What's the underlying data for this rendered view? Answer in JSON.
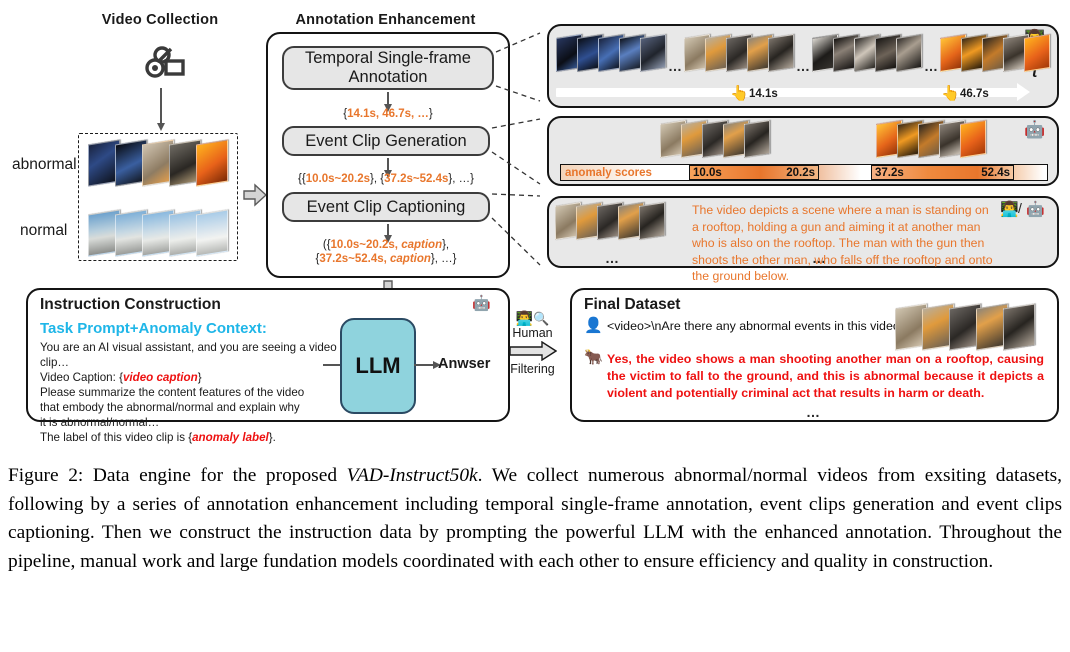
{
  "figure": {
    "headers": {
      "video_collection": "Video Collection",
      "annotation_enhancement": "Annotation Enhancement"
    },
    "video_collection": {
      "camera_icon": "video-camera-icon",
      "rows": [
        {
          "label": "abnormal"
        },
        {
          "label": "normal"
        }
      ]
    },
    "annotation_enhancement": {
      "steps": [
        {
          "label": "Temporal Single-frame Annotation"
        },
        {
          "label": "Event Clip Generation"
        },
        {
          "label": "Event Clip Captioning"
        }
      ],
      "outputs": [
        {
          "prefix": "{",
          "values": "14.1s, 46.7s, …",
          "suffix": "}"
        },
        {
          "line": "{{10.0s~20.2s}, {37.2s~52.4s}, …}"
        },
        {
          "line1": "({10.0s~20.2s, caption},",
          "line2": "{37.2s~52.4s, caption}, …}"
        }
      ]
    },
    "right_panels": {
      "timeline_panel": {
        "actor_icon": "person-technologist-icon",
        "axis_label": "t",
        "markers": [
          {
            "icon": "pointing-hand-icon",
            "label": "14.1s"
          },
          {
            "icon": "pointing-hand-icon",
            "label": "46.7s"
          }
        ],
        "ellipses": [
          "…",
          "…",
          "…"
        ]
      },
      "scores_panel": {
        "actor_icon": "robot-icon",
        "bar_label": "anomaly scores",
        "segments": [
          {
            "start": "10.0s",
            "end": "20.2s"
          },
          {
            "start": "37.2s",
            "end": "52.4s"
          }
        ]
      },
      "caption_panel": {
        "actor_icon": "person-technologist-and-robot-icon",
        "actor_icon_separator": "/",
        "text": "The video depicts a scene where a man is standing on a rooftop, holding a gun and aiming it at another man who is also on the rooftop. The man with the gun then shoots the other man, who falls off the rooftop and onto the ground below.",
        "ellipsis_left": "…",
        "ellipsis_right": "…"
      }
    },
    "instruction_construction": {
      "title": "Instruction Construction",
      "actor_icon": "robot-icon",
      "prompt_heading": "Task Prompt+Anomaly Context:",
      "prompt_lines": [
        "You are an AI visual assistant, and you are seeing a video clip…",
        "Video Caption: {video caption}",
        "Please summarize the content features of the video",
        "that embody the abnormal/normal and explain why",
        "it is abnormal/normal…",
        "The label of this video clip is {anomaly label}."
      ],
      "video_caption_placeholder": "video caption",
      "anomaly_label_placeholder": "anomaly label",
      "llm_label": "LLM",
      "answer_label": "Anwser"
    },
    "human_filtering": {
      "icons": [
        "person-technologist-icon",
        "magnifying-glass-icon"
      ],
      "line1": "Human",
      "line2": "Filtering",
      "arrow_icon": "right-block-arrow-icon"
    },
    "final_dataset": {
      "title": "Final Dataset",
      "user_icon": "user-bust-icon",
      "assistant_icon": "ox-icon",
      "question": "<video>\\nAre there any abnormal events in this video?",
      "answer": "Yes, the video shows a man shooting another man on a rooftop, causing the victim to fall to the ground, and this is abnormal because it depicts a violent and potentially criminal act that results in harm or death.",
      "ellipsis": "…"
    },
    "colors": {
      "orange": "#e8762c",
      "red": "#ee1111",
      "cyan": "#1fb6e8",
      "llm_fill": "#8fd3dd",
      "panel_grey": "#e8e8e8",
      "step_fill": "#e6e6e6"
    }
  },
  "caption": {
    "prefix": "Figure 2: Data engine for the proposed ",
    "italic": "VAD-Instruct50k",
    "rest": ". We collect numerous abnormal/normal videos from exsiting datasets, following by a series of annotation enhancement including temporal single-frame annotation, event clips generation and event clips captioning. Then we construct the instruction data by prompting the powerful LLM with the enhanced annotation.  Throughout the pipeline, manual work and large fundation models coordinated with each other to ensure efficiency and quality in construction."
  }
}
